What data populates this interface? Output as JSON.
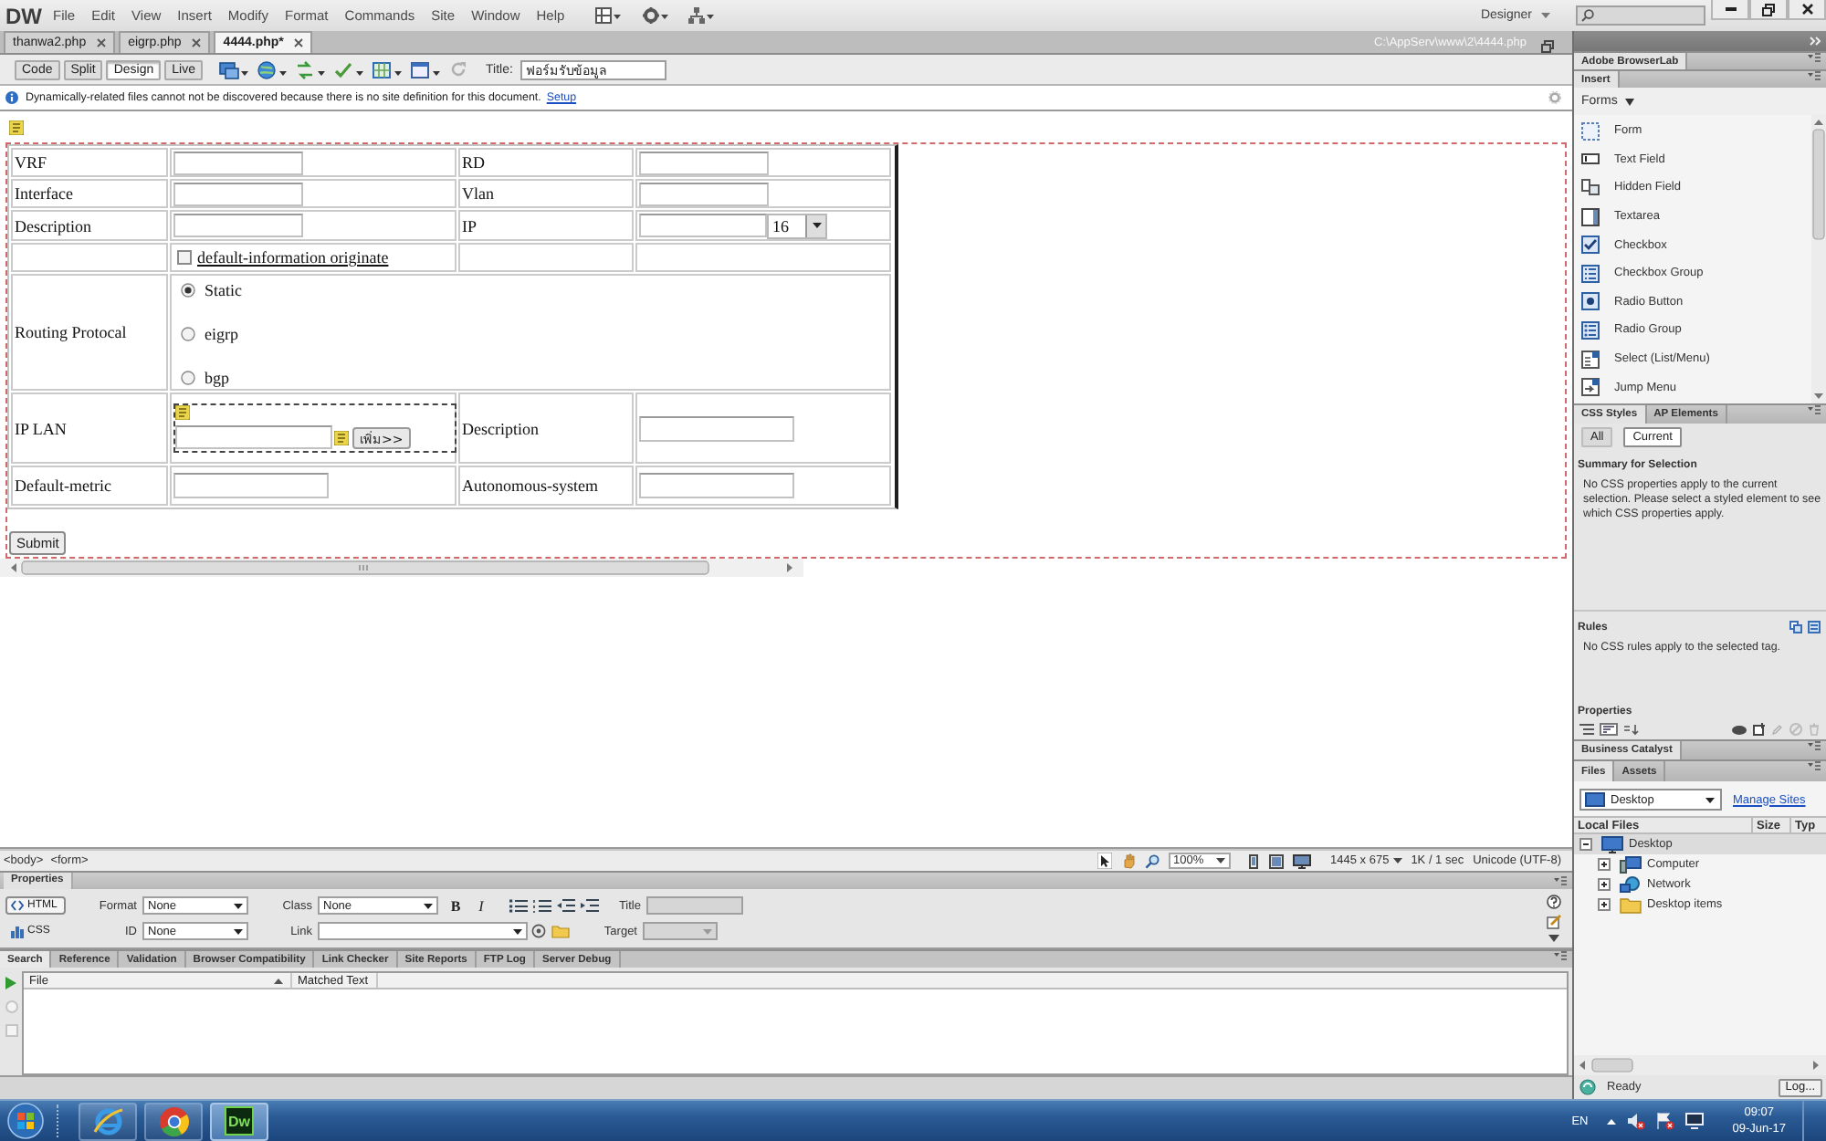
{
  "app_bar": {
    "logo": "DW",
    "menu": [
      "File",
      "Edit",
      "View",
      "Insert",
      "Modify",
      "Format",
      "Commands",
      "Site",
      "Window",
      "Help"
    ],
    "workspace": "Designer"
  },
  "document_tabs": [
    {
      "label": "thanwa2.php",
      "selected": false
    },
    {
      "label": "eigrp.php",
      "selected": false
    },
    {
      "label": "4444.php*",
      "selected": true
    }
  ],
  "file_path": "C:\\AppServ\\www\\2\\4444.php",
  "document_toolbar": {
    "views": [
      {
        "label": "Code",
        "selected": false
      },
      {
        "label": "Split",
        "selected": false
      },
      {
        "label": "Design",
        "selected": true
      },
      {
        "label": "Live",
        "selected": false
      }
    ],
    "title_label": "Title:",
    "title_value": "ฟอร์มรับข้อมูล"
  },
  "info_bar": {
    "message": "Dynamically-related files cannot not be discovered because there is no site definition for this document.",
    "link": "Setup"
  },
  "design_view": {
    "form_table": {
      "rows": [
        {
          "cells": [
            {
              "kind": "label",
              "text": "VRF"
            },
            {
              "kind": "input"
            },
            {
              "kind": "label",
              "text": "RD"
            },
            {
              "kind": "input"
            }
          ]
        },
        {
          "cells": [
            {
              "kind": "label",
              "text": "Interface"
            },
            {
              "kind": "input"
            },
            {
              "kind": "label",
              "text": "Vlan"
            },
            {
              "kind": "input"
            }
          ]
        },
        {
          "cells": [
            {
              "kind": "label",
              "text": "Description"
            },
            {
              "kind": "input"
            },
            {
              "kind": "label",
              "text": "IP"
            },
            {
              "kind": "input_select",
              "value": "16"
            }
          ]
        },
        {
          "cells": [
            {
              "kind": "empty"
            },
            {
              "kind": "checkbox",
              "label": "default-information originate",
              "checked": false
            },
            {
              "kind": "empty"
            },
            {
              "kind": "empty"
            }
          ]
        },
        {
          "cells": [
            {
              "kind": "label",
              "text": "Routing Protocal"
            },
            {
              "kind": "radios",
              "colspan": 3,
              "options": [
                {
                  "label": "Static",
                  "selected": true
                },
                {
                  "label": "eigrp",
                  "selected": false
                },
                {
                  "label": "bgp",
                  "selected": false
                }
              ]
            }
          ]
        },
        {
          "cells": [
            {
              "kind": "label",
              "text": "IP LAN"
            },
            {
              "kind": "input_button",
              "button": "เพิ่ม>>"
            },
            {
              "kind": "label",
              "text": "Description"
            },
            {
              "kind": "long_input"
            }
          ]
        },
        {
          "cells": [
            {
              "kind": "label",
              "text": "Default-metric"
            },
            {
              "kind": "long_input"
            },
            {
              "kind": "label",
              "text": "Autonomous-system"
            },
            {
              "kind": "long_input"
            }
          ]
        }
      ]
    },
    "submit": "Submit"
  },
  "status_bar": {
    "tags": [
      "<body>",
      "<form>"
    ],
    "zoom": "100%",
    "window_size": "1445 x 675",
    "download": "1K / 1 sec",
    "encoding": "Unicode (UTF-8)"
  },
  "properties": {
    "title": "Properties",
    "modes": [
      {
        "label": "HTML",
        "selected": true
      },
      {
        "label": "CSS",
        "selected": false
      }
    ],
    "format": {
      "label": "Format",
      "value": "None"
    },
    "id": {
      "label": "ID",
      "value": "None"
    },
    "class": {
      "label": "Class",
      "value": "None"
    },
    "bold": "B",
    "italic": "I",
    "link": {
      "label": "Link"
    },
    "title_field": {
      "label": "Title",
      "disabled": true
    },
    "target": {
      "label": "Target",
      "disabled": true
    }
  },
  "results": {
    "tabs": [
      {
        "label": "Search",
        "selected": true
      },
      {
        "label": "Reference",
        "selected": false
      },
      {
        "label": "Validation",
        "selected": false
      },
      {
        "label": "Browser Compatibility",
        "selected": false
      },
      {
        "label": "Link Checker",
        "selected": false
      },
      {
        "label": "Site Reports",
        "selected": false
      },
      {
        "label": "FTP Log",
        "selected": false
      },
      {
        "label": "Server Debug",
        "selected": false
      }
    ],
    "columns": [
      "File",
      "Matched Text"
    ]
  },
  "right_panel": {
    "browserlab_tab": "Adobe BrowserLab",
    "insert": {
      "tab": "Insert",
      "category": "Forms",
      "items": [
        "Form",
        "Text Field",
        "Hidden Field",
        "Textarea",
        "Checkbox",
        "Checkbox Group",
        "Radio Button",
        "Radio Group",
        "Select (List/Menu)",
        "Jump Menu"
      ]
    },
    "css_styles": {
      "tabs": [
        {
          "label": "CSS Styles",
          "selected": true
        },
        {
          "label": "AP Elements",
          "selected": false
        }
      ],
      "modes": [
        {
          "label": "All",
          "selected": false
        },
        {
          "label": "Current",
          "selected": true
        }
      ],
      "summary_title": "Summary for Selection",
      "summary_text": "No CSS properties apply to the current selection. Please select a styled element to see which CSS properties apply.",
      "rules_title": "Rules",
      "rules_text": "No CSS rules apply to the selected tag.",
      "properties_title": "Properties"
    },
    "business_catalyst_tab": "Business Catalyst",
    "files": {
      "tabs": [
        {
          "label": "Files",
          "selected": true
        },
        {
          "label": "Assets",
          "selected": false
        }
      ],
      "site": "Desktop",
      "manage_link": "Manage Sites",
      "columns": [
        "Local Files",
        "Size",
        "Typ"
      ],
      "tree": [
        {
          "label": "Desktop",
          "expanded": true,
          "selected": true,
          "children": [
            {
              "label": "Computer",
              "expanded": false,
              "selected": false
            },
            {
              "label": "Network",
              "expanded": false,
              "selected": false
            },
            {
              "label": "Desktop items",
              "expanded": false,
              "selected": false
            }
          ]
        }
      ],
      "status": "Ready",
      "log_button": "Log..."
    }
  },
  "taskbar": {
    "apps": [
      {
        "kind": "ie",
        "selected": false
      },
      {
        "kind": "chrome",
        "selected": false
      },
      {
        "kind": "dreamweaver",
        "label": "Dw",
        "selected": true
      }
    ],
    "language": "EN",
    "time": "09:07",
    "date": "09-Jun-17"
  }
}
